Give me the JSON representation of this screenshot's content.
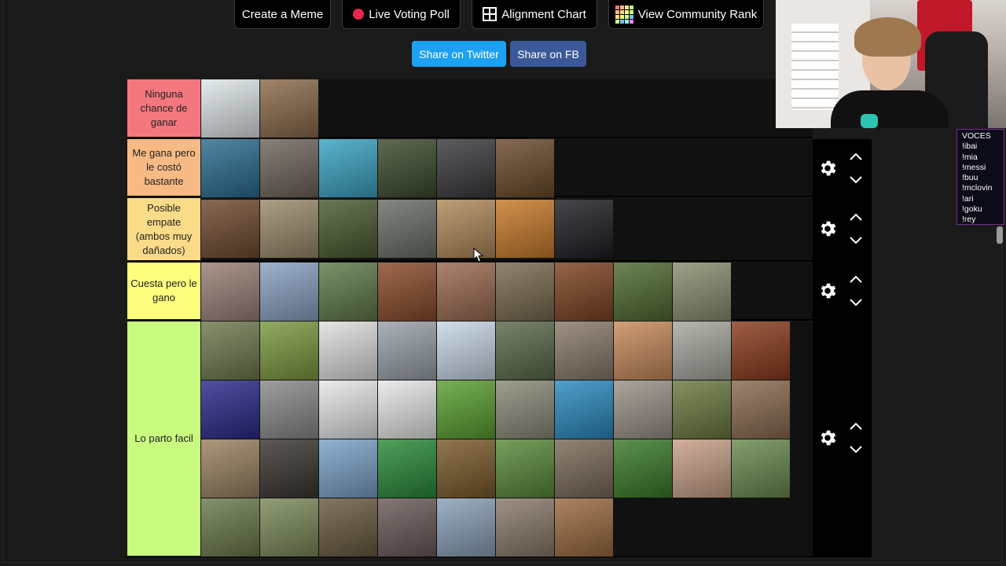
{
  "toolbar": {
    "buttons": [
      {
        "label": "Create a Meme",
        "icon": ""
      },
      {
        "label": "Live Voting Poll",
        "icon": "red-dot-icon"
      },
      {
        "label": "Alignment Chart",
        "icon": "grid-icon"
      },
      {
        "label": "View Community Rank",
        "icon": "rank-grid-icon"
      }
    ]
  },
  "share": {
    "twitter_label": "Share on Twitter",
    "facebook_label": "Share on FB"
  },
  "tiers": [
    {
      "label": "Ninguna chance de ganar",
      "color": "#f4777f",
      "items": [
        "polar-bear",
        "lion-pride"
      ]
    },
    {
      "label": "Me gana pero le costó bastante",
      "color": "#f7ba84",
      "items": [
        "humpback-whale",
        "elephant",
        "great-white-shark",
        "gorilla",
        "wolf",
        "lion"
      ]
    },
    {
      "label": "Posible empate (ambos muy dañados)",
      "color": "#fadc88",
      "items": [
        "grizzly-bear",
        "kangaroo",
        "cape-buffalo",
        "rhinoceros",
        "giraffe",
        "tiger",
        "black-panther"
      ]
    },
    {
      "label": "Cuesta pero le gano",
      "color": "#fdfd7e",
      "items": [
        "walrus",
        "ostrich",
        "deer",
        "orangutan",
        "pitbull",
        "hyena",
        "orangutan-2",
        "panda",
        "crocodile"
      ]
    },
    {
      "label": "Lo parto facil",
      "color": "#c8fb7f",
      "items": [
        "sloth",
        "chameleon",
        "scorpion",
        "emu",
        "penguin",
        "hippo-calf",
        "python",
        "meerkat",
        "seal-pup",
        "horse",
        "octopus",
        "crow",
        "cow",
        "bald-eagle",
        "parrot",
        "zebra",
        "dolphin",
        "harbor-seal",
        "squirrel",
        "koala",
        "cougar",
        "snapping-turtle",
        "bat",
        "tree-frog",
        "bull",
        "lapwing",
        "porcupine",
        "toucan",
        "armadillo",
        "anteater",
        "rabbit",
        "tortoise",
        "owl",
        "pygmy-hippo",
        "flamingo",
        "tarantula",
        "fox"
      ]
    }
  ],
  "item_colors": {
    "polar-bear": "#dfe6ea",
    "lion-pride": "#8a6a4a",
    "humpback-whale": "#2a6d8f",
    "elephant": "#6f655b",
    "great-white-shark": "#3aa3c4",
    "gorilla": "#3b4a2d",
    "wolf": "#3a3a3e",
    "lion": "#6a4a2a",
    "grizzly-bear": "#6e4a2e",
    "kangaroo": "#9a8a6a",
    "cape-buffalo": "#4a5a30",
    "rhinoceros": "#6a6e66",
    "giraffe": "#b08a5a",
    "tiger": "#c87a2a",
    "black-panther": "#1e1e22",
    "walrus": "#9a8076",
    "ostrich": "#8aa2c2",
    "deer": "#5e7a4a",
    "orangutan": "#8a4a2a",
    "pitbull": "#9a6a50",
    "hyena": "#7a6a50",
    "orangutan-2": "#7e4222",
    "panda": "#4e6a30",
    "crocodile": "#8a8e70",
    "sloth": "#6e7a4e",
    "chameleon": "#7a9a40",
    "scorpion": "#e0e0e0",
    "emu": "#9aa2a8",
    "penguin": "#c8d8e8",
    "hippo-calf": "#5a6a4a",
    "python": "#8a7a6a",
    "meerkat": "#c88a5a",
    "seal-pup": "#a8a8a0",
    "horse": "#8a3a1e",
    "octopus": "#2a2a8a",
    "crow": "#8a8a8a",
    "cow": "#e8e8e8",
    "bald-eagle": "#e8e8e8",
    "parrot": "#5aa030",
    "zebra": "#8a8a78",
    "dolphin": "#2a8ac0",
    "harbor-seal": "#9a9288",
    "squirrel": "#6a7a40",
    "koala": "#8a6a50",
    "cougar": "#9a8260",
    "snapping-turtle": "#3a3530",
    "bat": "#7aa2c8",
    "tree-frog": "#2a8a3a",
    "bull": "#7a5a2a",
    "lapwing": "#5a8a3a",
    "porcupine": "#7a6a58",
    "toucan": "#3a7a2a",
    "armadillo": "#c8a088",
    "anteater": "#6a8a50",
    "rabbit": "#6a7a4a",
    "tortoise": "#7a8a5a",
    "owl": "#6a5a40",
    "pygmy-hippo": "#6a5a58",
    "flamingo": "#8aa0b8",
    "tarantula": "#8a7a6a",
    "fox": "#9a6a40"
  },
  "voces_panel": {
    "title": "VOCES",
    "entries": [
      "!ibai",
      "!mia",
      "!messi",
      "!buu",
      "!mclovin",
      "!ari",
      "!goku",
      "!rey"
    ]
  }
}
